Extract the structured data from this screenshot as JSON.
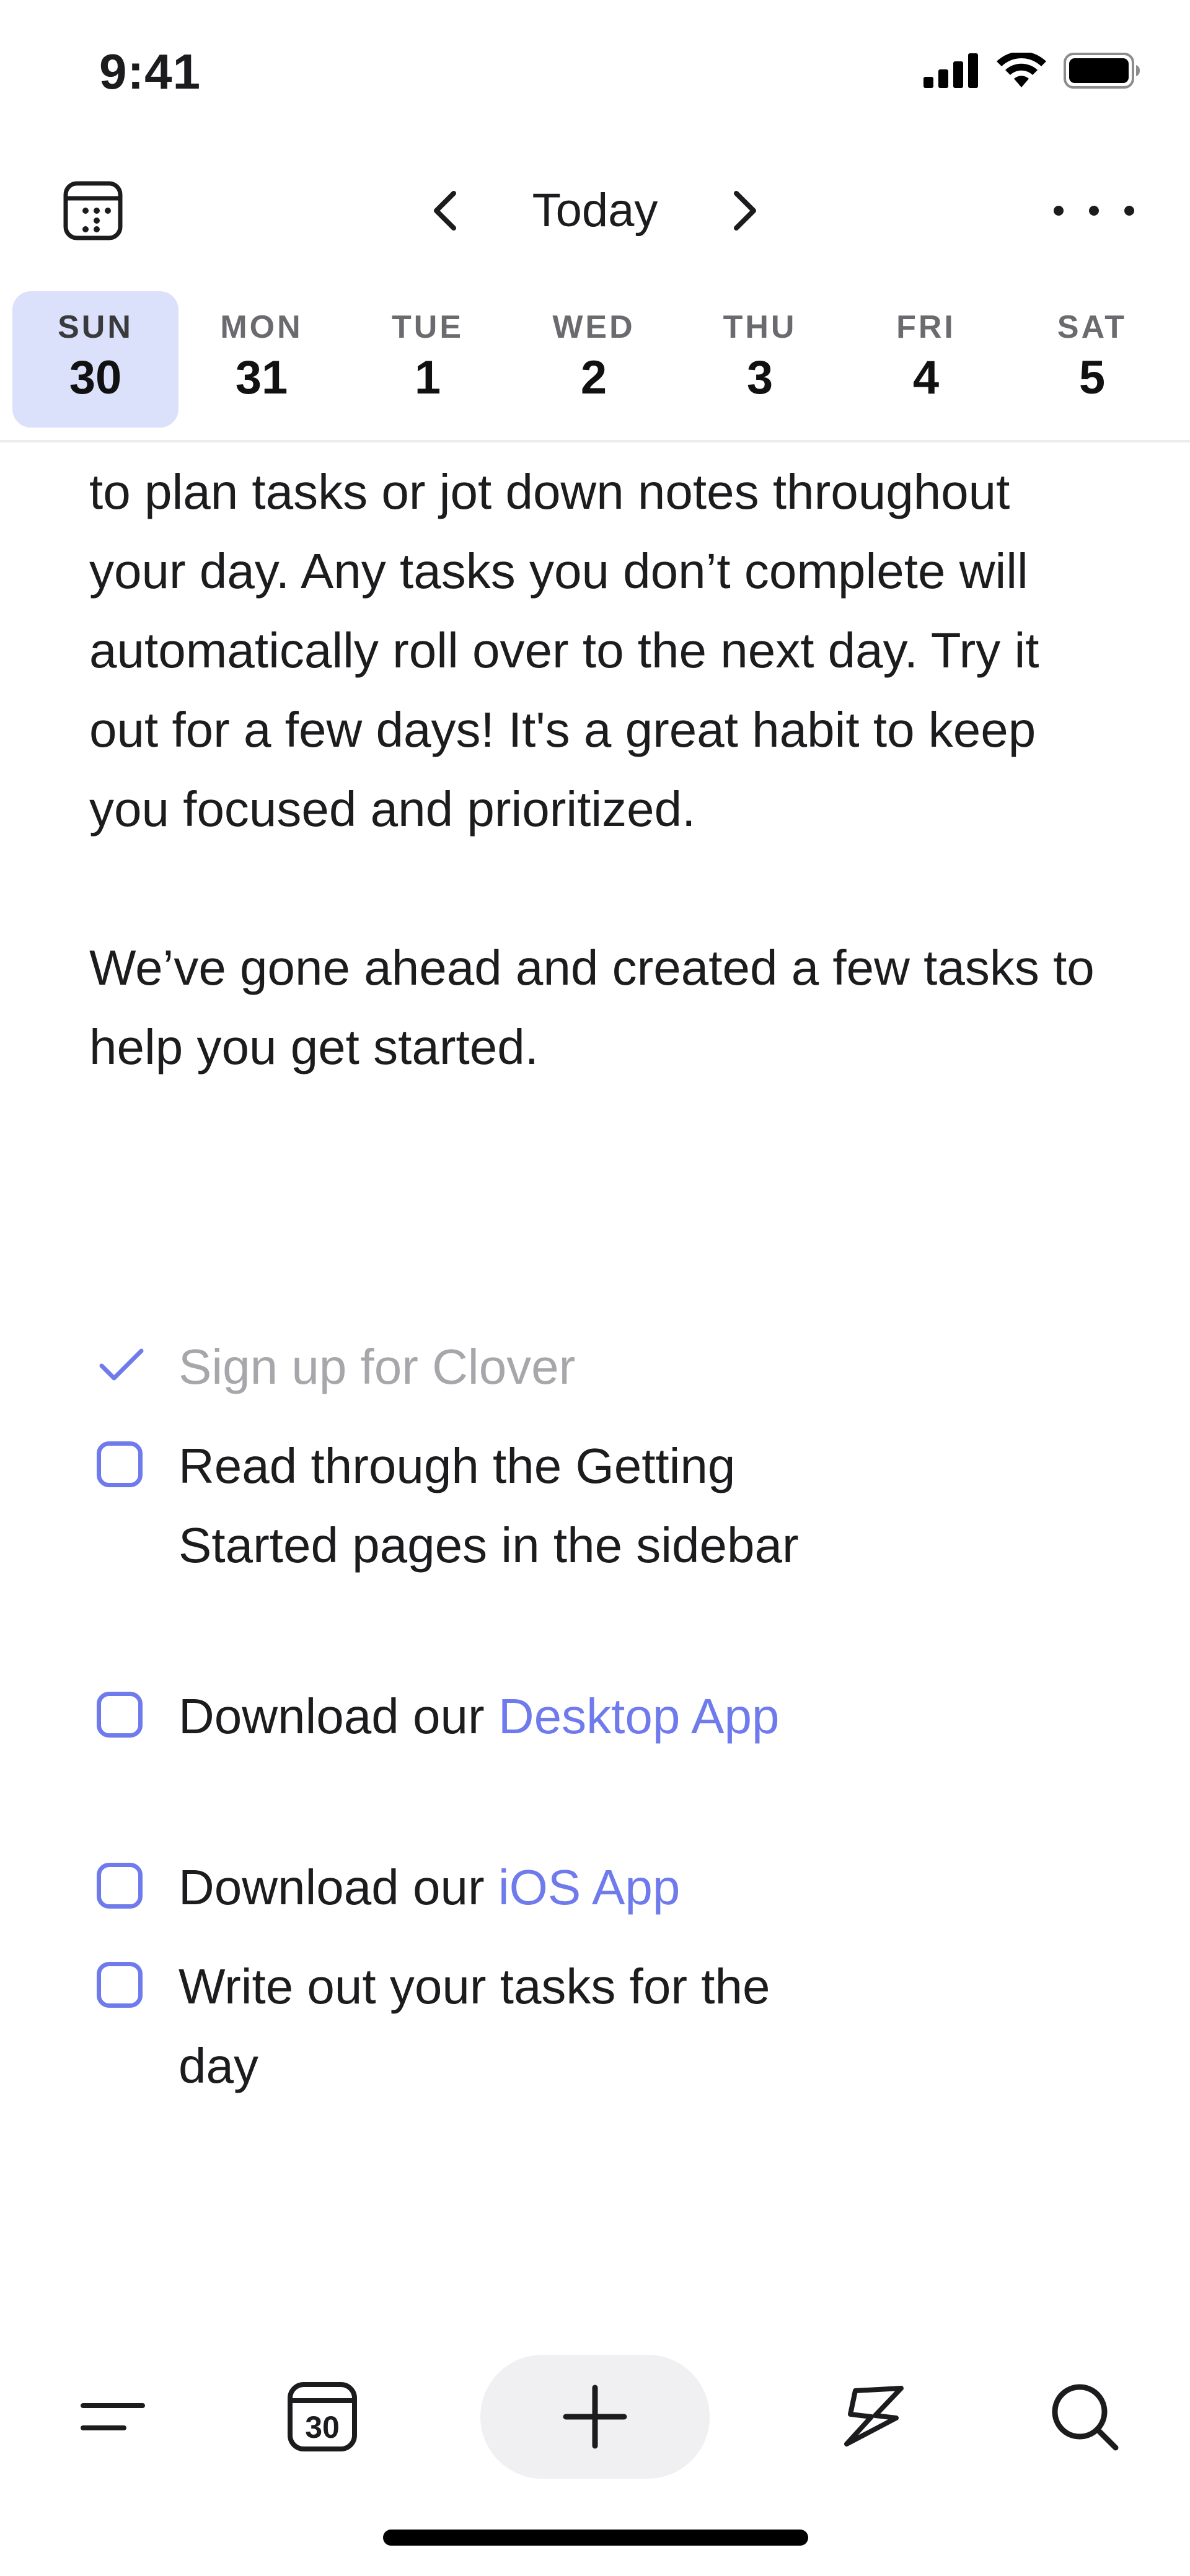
{
  "status_bar": {
    "time": "9:41"
  },
  "nav": {
    "title": "Today"
  },
  "week": [
    {
      "day": "SUN",
      "date": "30",
      "selected": true
    },
    {
      "day": "MON",
      "date": "31"
    },
    {
      "day": "TUE",
      "date": "1"
    },
    {
      "day": "WED",
      "date": "2"
    },
    {
      "day": "THU",
      "date": "3"
    },
    {
      "day": "FRI",
      "date": "4"
    },
    {
      "day": "SAT",
      "date": "5"
    }
  ],
  "body": {
    "paragraph_1": "to plan tasks or jot down notes throughout your day. Any tasks you don’t complete will automatically roll over to the next day. Try it out for a few days! It's a great habit to keep you focused and prioritized.",
    "paragraph_2": "We’ve gone ahead and created a few tasks to help you get started."
  },
  "tasks": [
    {
      "text": "Sign up for Clover",
      "done": true
    },
    {
      "text": "Read through the Getting Started pages in the sidebar",
      "done": false
    },
    {
      "prefix": "Download our ",
      "link": "Desktop App",
      "done": false
    },
    {
      "prefix": "Download our ",
      "link": "iOS App",
      "done": false
    },
    {
      "text": "Write out your tasks for the day",
      "done": false
    }
  ],
  "tab_bar": {
    "calendar_date": "30"
  },
  "colors": {
    "accent": "#6f7bec",
    "selected_day_bg": "#dbe0fb",
    "done_text": "#a6a6ab"
  },
  "icons": [
    "calendar-icon",
    "chevron-left-icon",
    "chevron-right-icon",
    "more-icon",
    "checkmark-icon",
    "menu-icon",
    "plus-icon",
    "lightning-icon",
    "search-icon"
  ]
}
